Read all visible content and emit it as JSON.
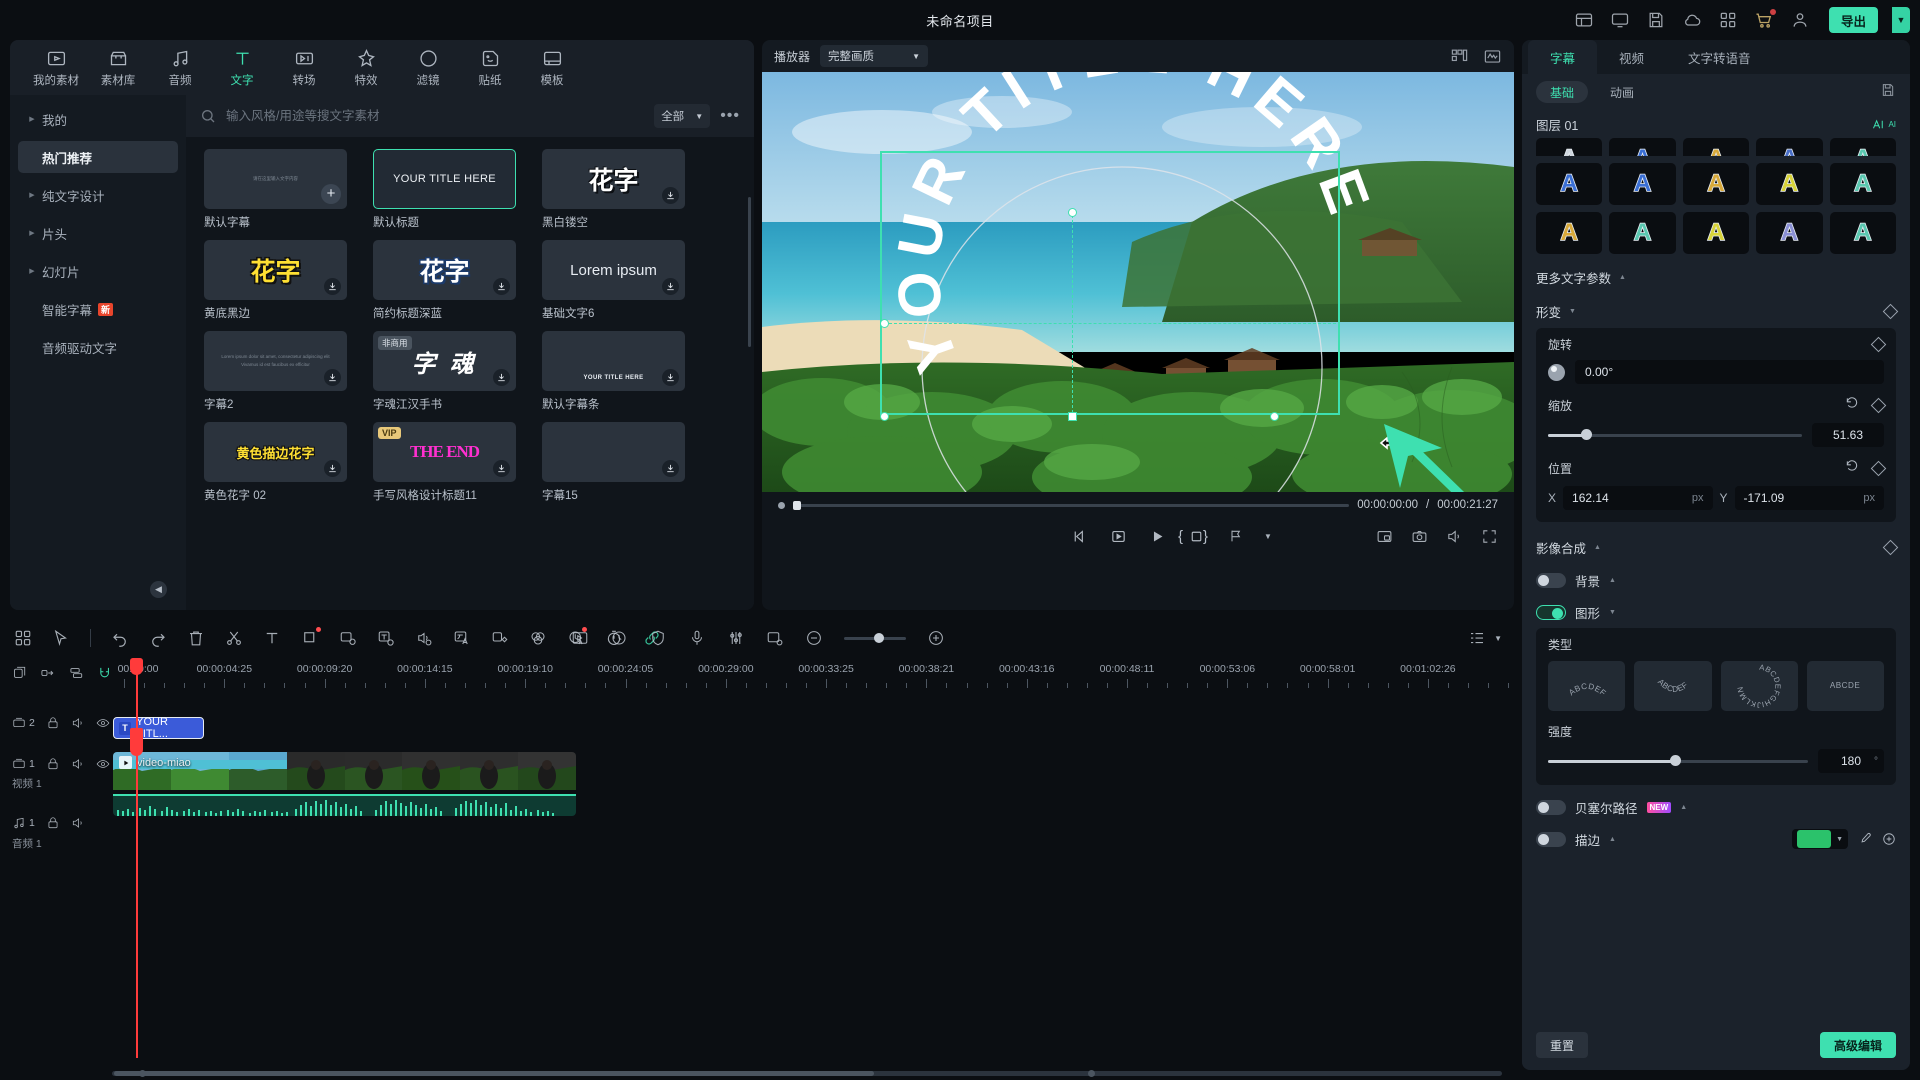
{
  "titlebar": {
    "project_name": "未命名项目",
    "export_label": "导出",
    "icons": [
      "template-icon",
      "monitor-icon",
      "save-icon",
      "cloud-icon",
      "grid-apps-icon",
      "cart-icon",
      "user-icon"
    ]
  },
  "tooltabs": [
    {
      "label": "我的素材",
      "icon": "media-icon",
      "active": false
    },
    {
      "label": "素材库",
      "icon": "store-icon",
      "active": false
    },
    {
      "label": "音频",
      "icon": "music-icon",
      "active": false
    },
    {
      "label": "文字",
      "icon": "text-icon",
      "active": true
    },
    {
      "label": "转场",
      "icon": "transition-icon",
      "active": false
    },
    {
      "label": "特效",
      "icon": "effects-icon",
      "active": false
    },
    {
      "label": "滤镜",
      "icon": "filter-icon",
      "active": false
    },
    {
      "label": "贴纸",
      "icon": "sticker-icon",
      "active": false
    },
    {
      "label": "模板",
      "icon": "template-pane-icon",
      "active": false
    }
  ],
  "nav": {
    "items": [
      {
        "label": "我的",
        "arrow": true,
        "selected": false,
        "badge": ""
      },
      {
        "label": "热门推荐",
        "arrow": false,
        "selected": true,
        "badge": ""
      },
      {
        "label": "纯文字设计",
        "arrow": true,
        "selected": false,
        "badge": ""
      },
      {
        "label": "片头",
        "arrow": true,
        "selected": false,
        "badge": ""
      },
      {
        "label": "幻灯片",
        "arrow": true,
        "selected": false,
        "badge": ""
      },
      {
        "label": "智能字幕",
        "arrow": false,
        "selected": false,
        "badge": "新"
      },
      {
        "label": "音频驱动文字",
        "arrow": false,
        "selected": false,
        "badge": ""
      }
    ]
  },
  "search": {
    "placeholder": "输入风格/用途等搜文字素材",
    "filter_label": "全部",
    "more_label": "•••"
  },
  "presets_grid": [
    {
      "caption": "默认字幕",
      "kind": "tiny",
      "text": "请在这里输入文字内容",
      "action": "plus",
      "tag": "",
      "selected": false
    },
    {
      "caption": "默认标题",
      "kind": "plain",
      "text": "YOUR TITLE HERE",
      "action": "",
      "tag": "",
      "selected": true
    },
    {
      "caption": "黑白镂空",
      "kind": "huazi",
      "text": "花字",
      "action": "download",
      "tag": "",
      "selected": false
    },
    {
      "caption": "黄底黑边",
      "kind": "huazi-y",
      "text": "花字",
      "action": "download",
      "tag": "",
      "selected": false
    },
    {
      "caption": "简约标题深蓝",
      "kind": "huazi-b",
      "text": "花字",
      "action": "download",
      "tag": "",
      "selected": false
    },
    {
      "caption": "基础文字6",
      "kind": "lorem",
      "text": "Lorem ipsum",
      "action": "download",
      "tag": "",
      "selected": false
    },
    {
      "caption": "字幕2",
      "kind": "tiny2",
      "text": "Lorem ipsum dolor sit amet, consectetur adipiscing elit\nVivamus id est faucibus ex efficitur",
      "action": "download",
      "tag": "",
      "selected": false
    },
    {
      "caption": "字魂江汉手书",
      "kind": "ziwen",
      "text": "字 魂",
      "action": "download",
      "tag": "非商用",
      "selected": false
    },
    {
      "caption": "默认字幕条",
      "kind": "subbar",
      "text": "YOUR TITLE HERE",
      "action": "download",
      "tag": "",
      "selected": false
    },
    {
      "caption": "黄色花字 02",
      "kind": "yellowout",
      "text": "黄色描边花字",
      "action": "download",
      "tag": "",
      "selected": false
    },
    {
      "caption": "手写风格设计标题11",
      "kind": "theend",
      "text": "THE END",
      "action": "download",
      "tag": "VIP",
      "selected": false
    },
    {
      "caption": "字幕15",
      "kind": "blank",
      "text": "",
      "action": "download",
      "tag": "",
      "selected": false
    }
  ],
  "player": {
    "label": "播放器",
    "quality_value": "完整画质",
    "current_time": "00:00:00:00",
    "total_time": "00:00:21:27",
    "separator": "/",
    "stage_text": "YOUR TITLE HERE",
    "icons_top": [
      "grid-layout-icon",
      "waveform-icon"
    ],
    "icons_left": [
      "snapshot-icon",
      "record-icon",
      "mark-icon",
      "mic-icon",
      "ratio-icon",
      "crop-icon",
      "compare-icon"
    ],
    "icons_right": [
      "pip-icon",
      "camera-icon",
      "volume-icon",
      "fullscreen-icon"
    ],
    "brace_left": "{",
    "brace_right": "}"
  },
  "right_panel": {
    "tabs": [
      {
        "label": "字幕",
        "active": true
      },
      {
        "label": "视频",
        "active": false
      },
      {
        "label": "文字转语音",
        "active": false
      }
    ],
    "subtabs": [
      {
        "label": "基础",
        "active": true
      },
      {
        "label": "动画",
        "active": false
      }
    ],
    "layer_label": "图层 01",
    "ai_label": "AI",
    "presets_rows": [
      [
        "#cfd6de",
        "#3b6fd4",
        "#d8a93a",
        "#4a6fc8",
        "#5bc8b0"
      ],
      [
        "#3b6fd4",
        "#3b6fd4",
        "#d8a93a",
        "#d8d33a",
        "#5bc8b0"
      ],
      [
        "#d8a93a",
        "#5bc8b0",
        "#d8d33a",
        "#8a8fd4",
        "#5bc8b0"
      ]
    ],
    "more_text_params": "更多文字参数",
    "transform": {
      "title": "形变",
      "rotate_label": "旋转",
      "rotate_value": "0.00°",
      "scale_label": "缩放",
      "scale_value": "51.63",
      "scale_pct": 15,
      "position_label": "位置",
      "x_label": "X",
      "x_value": "162.14",
      "y_label": "Y",
      "y_value": "-171.09",
      "unit": "px"
    },
    "composite": {
      "title": "影像合成",
      "background_label": "背景",
      "background_on": false,
      "shape_label": "图形",
      "shape_on": true,
      "type_label": "类型",
      "type_options": [
        "ABCDEFG",
        "ABCDEFG",
        "ABCDEFGHIJKLMN",
        "ABCDEFGH"
      ],
      "strength_label": "强度",
      "strength_value": "180",
      "strength_unit": "°",
      "strength_pct": 49,
      "bezier_label": "贝塞尔路径",
      "bezier_badge": "NEW",
      "bezier_on": false,
      "stroke_label": "描边",
      "stroke_on": false,
      "stroke_color": "#2bc26b"
    },
    "footer": {
      "reset_label": "重置",
      "advanced_label": "高级编辑"
    }
  },
  "timeline": {
    "toolbar_icons": [
      "apps-icon",
      "select-tool-icon",
      "undo-icon",
      "redo-icon",
      "delete-icon",
      "split-icon",
      "text-icon",
      "crop-icon",
      "color-match-icon",
      "auto-caption-icon",
      "silence-detect-icon",
      "translate-icon",
      "keyframe-icon",
      "color-icon",
      "audio-ai-icon",
      "speed-icon",
      "link-icon"
    ],
    "center_icons": [
      "render-icon",
      "marker-icon",
      "shield-icon",
      "mic-icon",
      "mixer-icon",
      "detect-icon",
      "ratio-icon"
    ],
    "zoom_out": "−",
    "zoom_in": "+",
    "right_icons": [
      "list-view-icon",
      "chevron-down-icon"
    ],
    "head_icons": [
      "add-track-icon",
      "link-track-icon",
      "manage-track-icon",
      "magnet-icon"
    ],
    "ruler_labels": [
      "00:00:00",
      "00:00:04:25",
      "00:00:09:20",
      "00:00:14:15",
      "00:00:19:10",
      "00:00:24:05",
      "00:00:29:00",
      "00:00:33:25",
      "00:00:38:21",
      "00:00:43:16",
      "00:00:48:11",
      "00:00:53:06",
      "00:00:58:01",
      "00:01:02:26"
    ],
    "tracks": [
      {
        "type": "text",
        "number": "2",
        "label": "",
        "clip_label": "YOUR TITL..."
      },
      {
        "type": "video",
        "number": "1",
        "label": "视频 1",
        "clip_label": "video-miao"
      },
      {
        "type": "audio",
        "number": "1",
        "label": "音频 1",
        "clip_label": ""
      }
    ]
  }
}
